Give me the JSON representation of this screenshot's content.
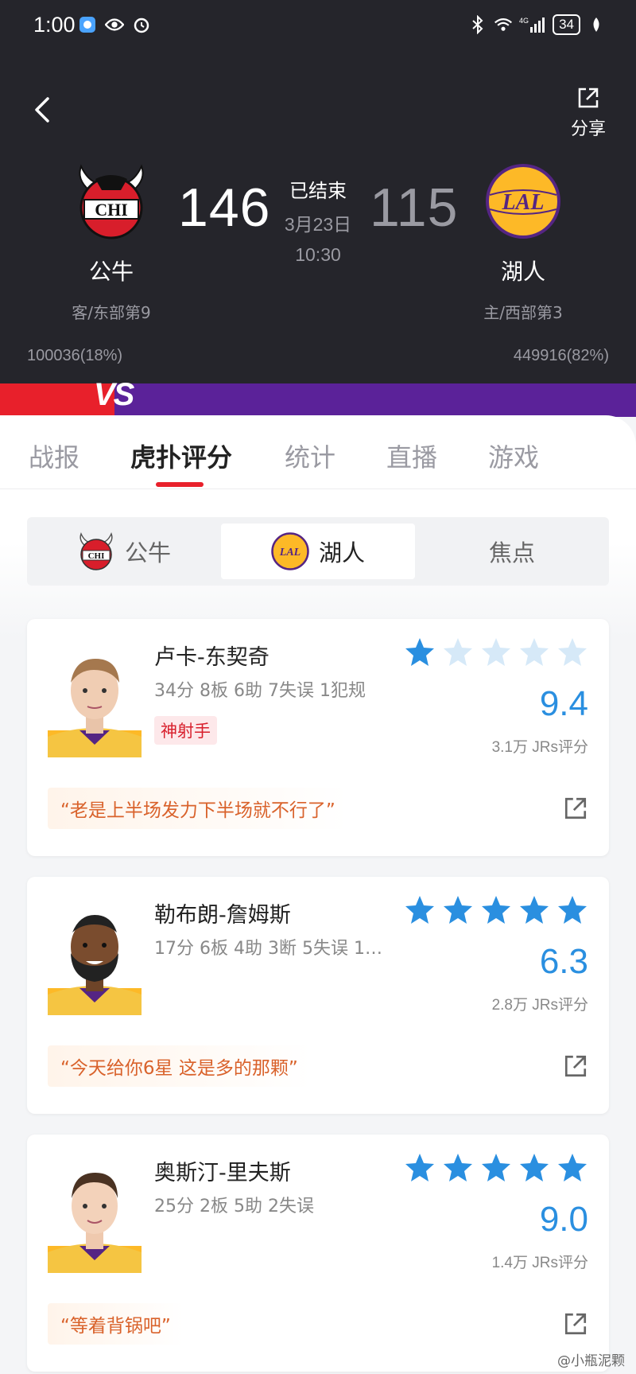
{
  "status_bar": {
    "time": "1:00",
    "battery": "34",
    "net": "4G"
  },
  "header": {
    "share_label": "分享",
    "game_status": "已结束",
    "game_date": "3月23日",
    "game_time": "10:30",
    "home": {
      "name": "公牛",
      "abbr": "CHI",
      "score": "146",
      "rank": "客/东部第9",
      "votes": "100036(18%)",
      "color": "#e8202b"
    },
    "away": {
      "name": "湖人",
      "abbr": "LAL",
      "score": "115",
      "rank": "主/西部第3",
      "votes": "449916(82%)",
      "color": "#5b2299"
    },
    "vs_text": "VS",
    "vote_share_home": 0.18
  },
  "tabs": [
    {
      "label": "战报",
      "active": false
    },
    {
      "label": "虎扑评分",
      "active": true
    },
    {
      "label": "统计",
      "active": false
    },
    {
      "label": "直播",
      "active": false
    },
    {
      "label": "游戏",
      "active": false
    }
  ],
  "team_segment": [
    {
      "label": "公牛",
      "icon": "chi-logo-icon",
      "active": false
    },
    {
      "label": "湖人",
      "icon": "lal-logo-icon",
      "active": true
    },
    {
      "label": "焦点",
      "active": false
    }
  ],
  "players": [
    {
      "name": "卢卡-东契奇",
      "stats": "34分 8板 6助 7失误 1犯规",
      "tag": "神射手",
      "stars_filled": 1,
      "rating": "9.4",
      "rating_count": "3.1万 JRs评分",
      "quote": "“老是上半场发力下半场就不行了”"
    },
    {
      "name": "勒布朗-詹姆斯",
      "stats": "17分 6板 4助 3断 5失误 1…",
      "tag": "",
      "stars_filled": 5,
      "rating": "6.3",
      "rating_count": "2.8万 JRs评分",
      "quote": "“今天给你6星 这是多的那颗”"
    },
    {
      "name": "奥斯汀-里夫斯",
      "stats": "25分 2板 5助 2失误",
      "tag": "",
      "stars_filled": 5,
      "rating": "9.0",
      "rating_count": "1.4万 JRs评分",
      "quote": "“等着背锅吧”"
    }
  ],
  "watermark": "@小瓶泥颗",
  "colors": {
    "accent_red": "#e8202b",
    "star_blue": "#2a8fe0",
    "star_empty": "#d6e9f8",
    "quote_orange": "#d9622b"
  }
}
